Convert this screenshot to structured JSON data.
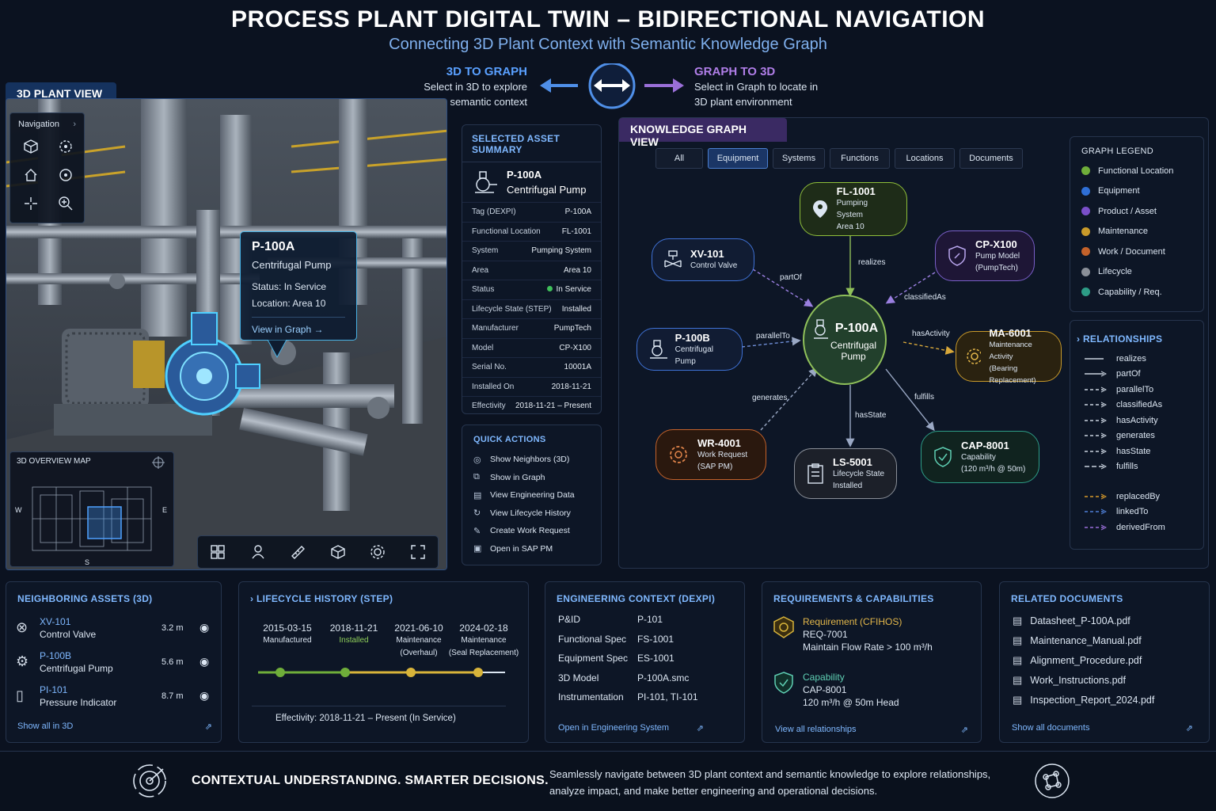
{
  "header": {
    "title": "PROCESS PLANT DIGITAL TWIN – BIDIRECTIONAL NAVIGATION",
    "subtitle": "Connecting 3D Plant Context with Semantic Knowledge Graph"
  },
  "nav_hint": {
    "left_title": "3D TO GRAPH",
    "left_l1": "Select in 3D to explore",
    "left_l2": "semantic context",
    "right_title": "GRAPH TO 3D",
    "right_l1": "Select in Graph to locate in",
    "right_l2": "3D plant environment"
  },
  "plant_view": {
    "tab": "3D PLANT VIEW",
    "navigation_label": "Navigation",
    "callout": {
      "name": "P-100A",
      "type": "Centrifugal Pump",
      "status_label": "Status:",
      "status": "In Service",
      "location_label": "Location:",
      "location": "Area 10",
      "button": "View in Graph"
    },
    "minimap": {
      "title": "3D OVERVIEW MAP",
      "w": "W",
      "e": "E",
      "s": "S"
    }
  },
  "summary": {
    "title": "SELECTED ASSET SUMMARY",
    "name": "P-100A",
    "type": "Centrifugal Pump",
    "rows": [
      {
        "k": "Tag (DEXPI)",
        "v": "P-100A"
      },
      {
        "k": "Functional Location",
        "v": "FL-1001"
      },
      {
        "k": "System",
        "v": "Pumping System"
      },
      {
        "k": "Area",
        "v": "Area 10"
      },
      {
        "k": "Status",
        "v": "In Service"
      },
      {
        "k": "Lifecycle State (STEP)",
        "v": "Installed"
      },
      {
        "k": "Manufacturer",
        "v": "PumpTech"
      },
      {
        "k": "Model",
        "v": "CP-X100"
      },
      {
        "k": "Serial No.",
        "v": "10001A"
      },
      {
        "k": "Installed On",
        "v": "2018-11-21"
      },
      {
        "k": "Effectivity",
        "v": "2018-11-21 – Present"
      }
    ],
    "status_color": "#3fbf5a"
  },
  "quick_actions": {
    "title": "QUICK ACTIONS",
    "items": [
      "Show Neighbors (3D)",
      "Show in Graph",
      "View Engineering Data",
      "View Lifecycle History",
      "Create Work Request",
      "Open in SAP PM"
    ]
  },
  "graph": {
    "tab": "KNOWLEDGE GRAPH VIEW",
    "filters": [
      "All",
      "Equipment",
      "Systems",
      "Functions",
      "Locations",
      "Documents"
    ],
    "center": {
      "id": "P-100A",
      "l1": "Centrifugal",
      "l2": "Pump"
    },
    "nodes": {
      "fl": {
        "id": "FL-1001",
        "l1": "Pumping System",
        "l2": "Area 10"
      },
      "xv": {
        "id": "XV-101",
        "l1": "Control Valve"
      },
      "cp": {
        "id": "CP-X100",
        "l1": "Pump Model",
        "l2": "(PumpTech)"
      },
      "pb": {
        "id": "P-100B",
        "l1": "Centrifugal Pump"
      },
      "ma": {
        "id": "MA-6001",
        "l1": "Maintenance Activity",
        "l2": "(Bearing Replacement)"
      },
      "wr": {
        "id": "WR-4001",
        "l1": "Work Request",
        "l2": "(SAP PM)"
      },
      "ls": {
        "id": "LS-5001",
        "l1": "Lifecycle State",
        "l2": "Installed"
      },
      "cap": {
        "id": "CAP-8001",
        "l1": "Capability",
        "l2": "(120 m³/h @ 50m)"
      }
    },
    "edges": {
      "realizes": "realizes",
      "partOf": "partOf",
      "classifiedAs": "classifiedAs",
      "parallelTo": "parallelTo",
      "hasActivity": "hasActivity",
      "generates": "generates",
      "hasState": "hasState",
      "fulfills": "fulfills"
    }
  },
  "legend": {
    "title": "GRAPH LEGEND",
    "items": [
      {
        "label": "Functional Location",
        "color": "#6fae3a"
      },
      {
        "label": "Equipment",
        "color": "#2f6fd6"
      },
      {
        "label": "Product / Asset",
        "color": "#7a4fc9"
      },
      {
        "label": "Maintenance",
        "color": "#c99a2a"
      },
      {
        "label": "Work / Document",
        "color": "#c4622a"
      },
      {
        "label": "Lifecycle",
        "color": "#8a8f98"
      },
      {
        "label": "Capability / Req.",
        "color": "#2d9c86"
      }
    ]
  },
  "relationships": {
    "title": "RELATIONSHIPS",
    "items": [
      {
        "label": "realizes",
        "color": "#c9d2de",
        "dash": "0"
      },
      {
        "label": "partOf",
        "color": "#c9d2de",
        "dash": "0"
      },
      {
        "label": "parallelTo",
        "color": "#c9d2de",
        "dash": "4 3"
      },
      {
        "label": "classifiedAs",
        "color": "#c9d2de",
        "dash": "4 3"
      },
      {
        "label": "hasActivity",
        "color": "#c9d2de",
        "dash": "4 3"
      },
      {
        "label": "generates",
        "color": "#c9d2de",
        "dash": "4 3"
      },
      {
        "label": "hasState",
        "color": "#c9d2de",
        "dash": "4 3"
      },
      {
        "label": "fulfills",
        "color": "#c9d2de",
        "dash": "6 3"
      },
      {
        "label": "replacedBy",
        "color": "#d89a2a",
        "dash": "4 3"
      },
      {
        "label": "linkedTo",
        "color": "#4f7fd6",
        "dash": "4 3"
      },
      {
        "label": "derivedFrom",
        "color": "#9a6fd8",
        "dash": "4 3"
      }
    ]
  },
  "neighbors": {
    "title": "NEIGHBORING ASSETS (3D)",
    "items": [
      {
        "id": "XV-101",
        "type": "Control Valve",
        "dist": "3.2 m"
      },
      {
        "id": "P-100B",
        "type": "Centrifugal Pump",
        "dist": "5.6 m"
      },
      {
        "id": "PI-101",
        "type": "Pressure Indicator",
        "dist": "8.7 m"
      }
    ],
    "link": "Show all in 3D"
  },
  "lifecycle": {
    "title": "LIFECYCLE HISTORY (STEP)",
    "events": [
      {
        "date": "2015-03-15",
        "l1": "Manufactured",
        "l2": ""
      },
      {
        "date": "2018-11-21",
        "l1": "Installed",
        "l2": ""
      },
      {
        "date": "2021-06-10",
        "l1": "Maintenance",
        "l2": "(Overhaul)"
      },
      {
        "date": "2024-02-18",
        "l1": "Maintenance",
        "l2": "(Seal Replacement)"
      }
    ],
    "effectivity_label": "Effectivity:",
    "effectivity": "2018-11-21 – Present (In Service)"
  },
  "engineering": {
    "title": "ENGINEERING CONTEXT (DEXPI)",
    "rows": [
      {
        "k": "P&ID",
        "v": "P-101"
      },
      {
        "k": "Functional Spec",
        "v": "FS-1001"
      },
      {
        "k": "Equipment Spec",
        "v": "ES-1001"
      },
      {
        "k": "3D Model",
        "v": "P-100A.smc"
      },
      {
        "k": "Instrumentation",
        "v": "PI-101, TI-101"
      }
    ],
    "link": "Open in Engineering System"
  },
  "requirements": {
    "title": "REQUIREMENTS & CAPABILITIES",
    "req": {
      "t": "Requirement (CFIHOS)",
      "id": "REQ-7001",
      "d": "Maintain Flow Rate > 100 m³/h"
    },
    "cap": {
      "t": "Capability",
      "id": "CAP-8001",
      "d": "120 m³/h @ 50m Head"
    },
    "link": "View all relationships"
  },
  "documents": {
    "title": "RELATED DOCUMENTS",
    "items": [
      "Datasheet_P-100A.pdf",
      "Maintenance_Manual.pdf",
      "Alignment_Procedure.pdf",
      "Work_Instructions.pdf",
      "Inspection_Report_2024.pdf"
    ],
    "link": "Show all documents"
  },
  "footer": {
    "tagline": "CONTEXTUAL UNDERSTANDING. SMARTER DECISIONS.",
    "l1": "Seamlessly navigate between 3D plant context and semantic knowledge to explore relationships,",
    "l2": "analyze impact, and make better engineering and operational decisions."
  }
}
